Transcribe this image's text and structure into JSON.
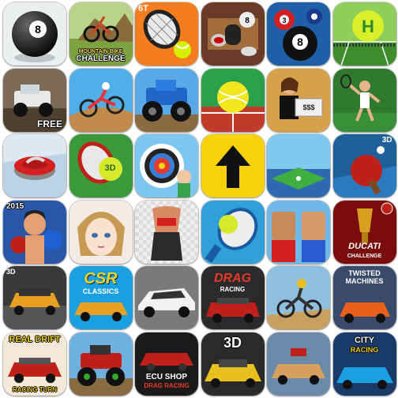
{
  "apps": [
    {
      "name": "8 ball pool",
      "label": "8"
    },
    {
      "name": "mountain bike challenge",
      "label": "CHALLENGE"
    },
    {
      "name": "tennis racket",
      "label": "6T"
    },
    {
      "name": "bowling pins",
      "label": "8"
    },
    {
      "name": "billiards pool",
      "label": "8"
    },
    {
      "name": "tennis court",
      "label": "H"
    },
    {
      "name": "monster truck offroad",
      "label": "FREE"
    },
    {
      "name": "motocross dirt bike",
      "label": ""
    },
    {
      "name": "monster truck blue",
      "label": ""
    },
    {
      "name": "tennis ball court",
      "label": ""
    },
    {
      "name": "casino woman",
      "label": "$$$"
    },
    {
      "name": "tennis player",
      "label": ""
    },
    {
      "name": "curling stone",
      "label": ""
    },
    {
      "name": "3d tennis racket",
      "label": "3D"
    },
    {
      "name": "archery target",
      "label": ""
    },
    {
      "name": "up arrow",
      "label": ""
    },
    {
      "name": "mini golf",
      "label": ""
    },
    {
      "name": "3d ping pong",
      "label": "3D"
    },
    {
      "name": "boxing 2015",
      "label": "2015"
    },
    {
      "name": "anime character",
      "label": ""
    },
    {
      "name": "fitness woman",
      "label": ""
    },
    {
      "name": "tennis ball racket",
      "label": ""
    },
    {
      "name": "fighter heads",
      "label": ""
    },
    {
      "name": "ducati challenge",
      "label": "DUCATI"
    },
    {
      "name": "3d racing car",
      "label": "3D"
    },
    {
      "name": "csr classics",
      "label": "CSR"
    },
    {
      "name": "white sports car",
      "label": ""
    },
    {
      "name": "drag racing",
      "label": "DRAG"
    },
    {
      "name": "dirt bike rider",
      "label": ""
    },
    {
      "name": "twisted machines",
      "label": "TWISTED MACHINES"
    },
    {
      "name": "real drift racing",
      "label": "REAL DRIFT"
    },
    {
      "name": "monster truck green",
      "label": ""
    },
    {
      "name": "ecu shop drag racing",
      "label": "ECU SHOP"
    },
    {
      "name": "3d sports car",
      "label": "3D"
    },
    {
      "name": "demolition derby",
      "label": ""
    },
    {
      "name": "city racing",
      "label": "CITY RACING"
    }
  ],
  "labels": {
    "bike_sub": "MOUNTAIN BIKE",
    "csr_sub": "CLASSICS",
    "drag_sub": "RACING",
    "ducati_sub": "CHALLENGE",
    "drift_sub": "RACING TURN",
    "ecu_sub": "DRAG RACING",
    "twisted_top": "TWISTED",
    "twisted_bottom": "MACHINES",
    "city_top": "CITY",
    "city_bottom": "RACING"
  }
}
